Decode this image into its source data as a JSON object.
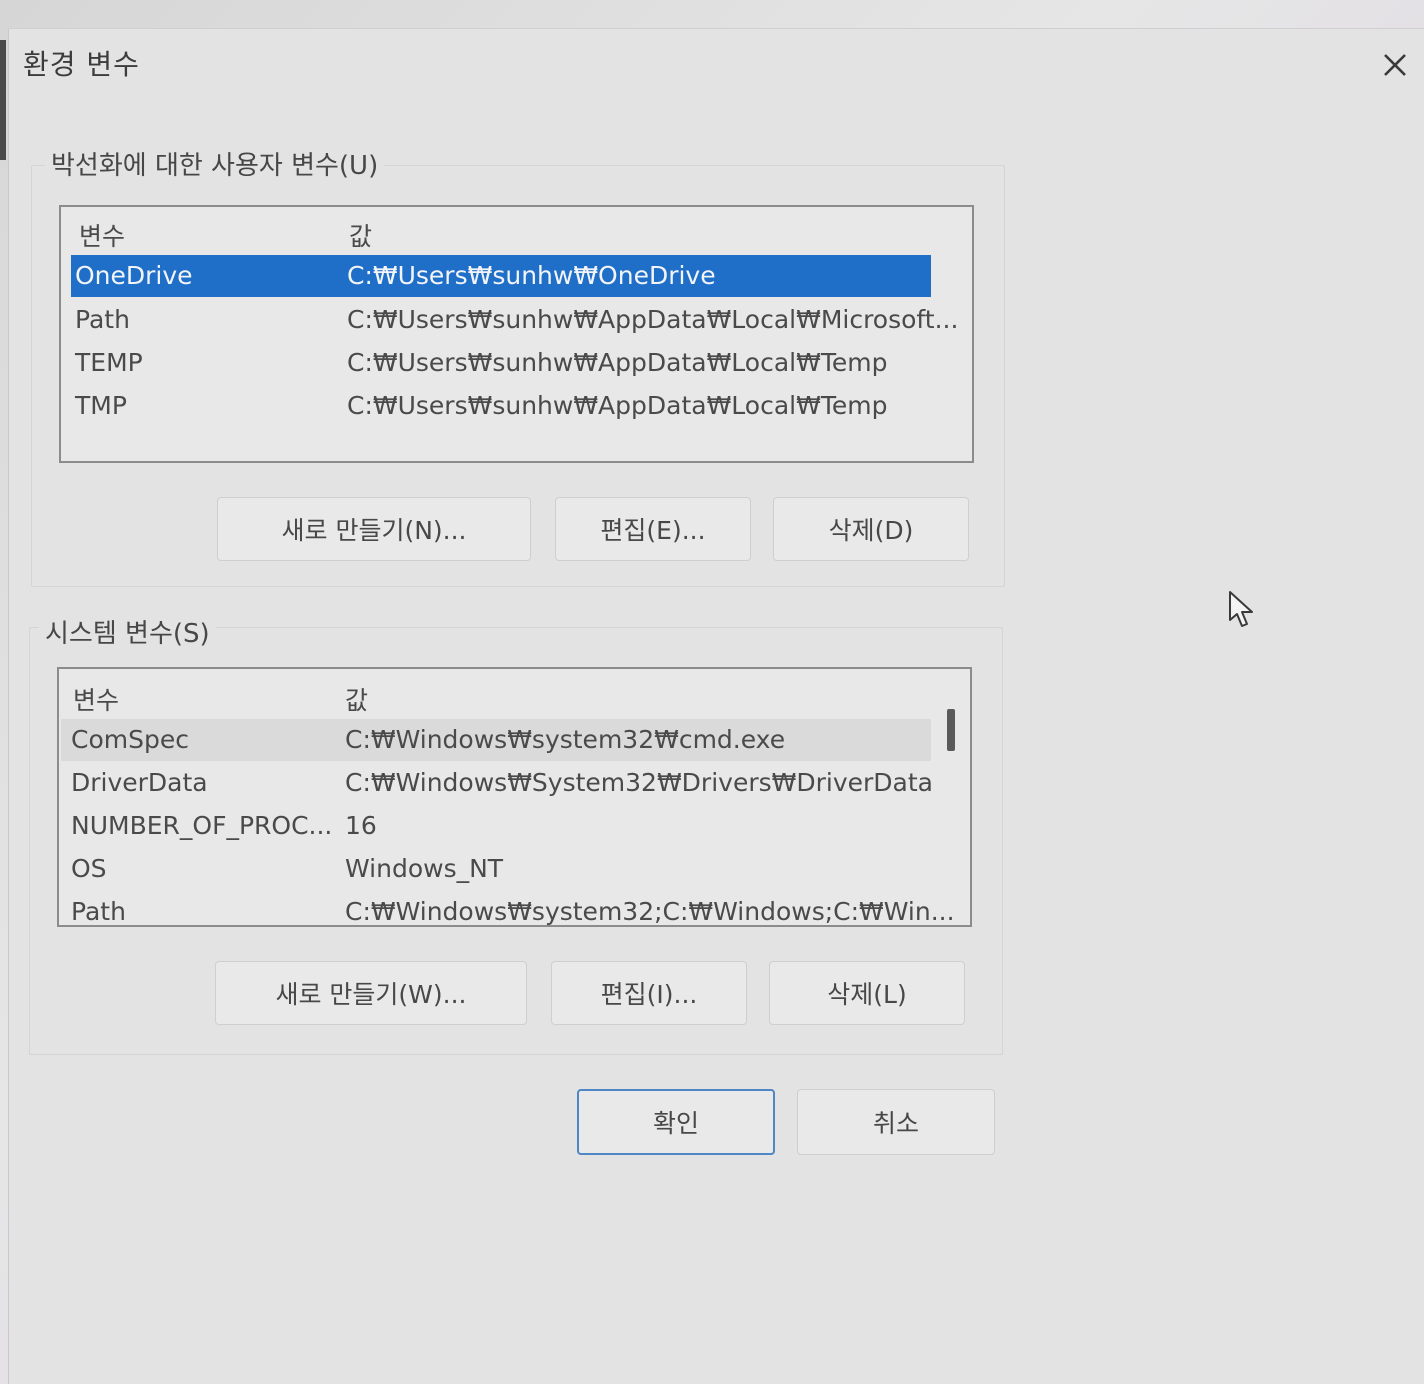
{
  "window": {
    "title": "환경 변수",
    "close_label": "✕"
  },
  "user_vars": {
    "group_label": "박선화에 대한 사용자 변수(U)",
    "header": {
      "name": "변수",
      "value": "값"
    },
    "rows": [
      {
        "name": "OneDrive",
        "value": "C:₩Users₩sunhw₩OneDrive"
      },
      {
        "name": "Path",
        "value": "C:₩Users₩sunhw₩AppData₩Local₩Microsoft..."
      },
      {
        "name": "TEMP",
        "value": "C:₩Users₩sunhw₩AppData₩Local₩Temp"
      },
      {
        "name": "TMP",
        "value": "C:₩Users₩sunhw₩AppData₩Local₩Temp"
      }
    ],
    "selected_row": "OneDrive",
    "buttons": {
      "new": "새로 만들기(N)...",
      "edit": "편집(E)...",
      "delete": "삭제(D)"
    }
  },
  "system_vars": {
    "group_label": "시스템 변수(S)",
    "header": {
      "name": "변수",
      "value": "값"
    },
    "rows": [
      {
        "name": "ComSpec",
        "value": "C:₩Windows₩system32₩cmd.exe"
      },
      {
        "name": "DriverData",
        "value": "C:₩Windows₩System32₩Drivers₩DriverData"
      },
      {
        "name": "NUMBER_OF_PROC...",
        "value": "16"
      },
      {
        "name": "OS",
        "value": "Windows_NT"
      },
      {
        "name": "Path",
        "value": "C:₩Windows₩system32;C:₩Windows;C:₩Win..."
      }
    ],
    "buttons": {
      "new": "새로 만들기(W)...",
      "edit": "편집(I)...",
      "delete": "삭제(L)"
    }
  },
  "footer": {
    "ok": "확인",
    "cancel": "취소"
  },
  "colors": {
    "selection": "#1f6fc8",
    "default_button_border": "#4f86c6"
  }
}
